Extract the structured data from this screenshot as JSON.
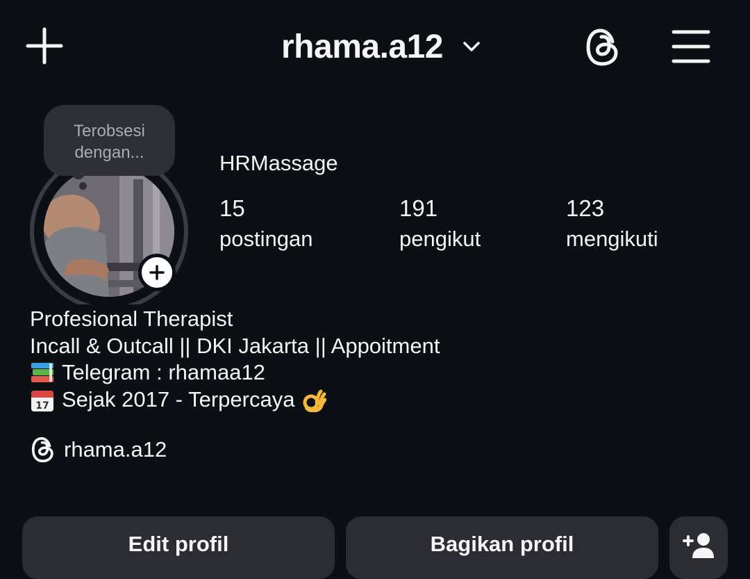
{
  "header": {
    "username": "rhama.a12"
  },
  "profile": {
    "note": "Terobsesi dengan...",
    "display_name": "HRMassage",
    "stats": [
      {
        "number": "15",
        "label": "postingan"
      },
      {
        "number": "191",
        "label": "pengikut"
      },
      {
        "number": "123",
        "label": "mengikuti"
      }
    ],
    "bio": [
      "Profesional Therapist",
      "Incall & Outcall || DKI Jakarta || Appoitment",
      "Telegram : rhamaa12",
      "Sejak 2017 - Terpercaya"
    ],
    "threads_handle": "rhama.a12"
  },
  "actions": {
    "edit_label": "Edit profil",
    "share_label": "Bagikan profil"
  },
  "colors": {
    "background": "#0c0f14",
    "button": "#2b2d33",
    "note_bubble": "#2e3035",
    "text": "#f5f5f5"
  },
  "icons": [
    "plus-icon",
    "chevron-down-icon",
    "threads-icon",
    "menu-icon",
    "books-emoji",
    "calendar-emoji",
    "ok-hand-emoji",
    "add-person-icon"
  ]
}
